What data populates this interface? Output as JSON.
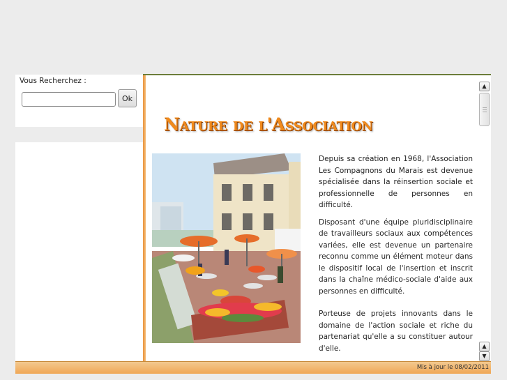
{
  "search": {
    "label": "Vous Recherchez :",
    "input_value": "",
    "ok_label": "Ok"
  },
  "main": {
    "title": "Nature de l'Association",
    "paragraphs": [
      "Depuis sa création en 1968, l'Association Les Compagnons du Marais est devenue spécialisée dans la réinsertion sociale et professionnelle de personnes en difficulté.",
      "Disposant d'une équipe pluridisciplinaire de travailleurs sociaux aux compétences variées, elle est devenue un partenaire reconnu comme un élément moteur dans le dispositif local de l'insertion et inscrit dans la chaîne médico-sociale d'aide aux personnes en difficulté.",
      "Porteuse de projets innovants dans le domaine de l'action sociale et riche du partenariat qu'elle a su constituer autour d'elle."
    ],
    "scroll_up": "▲",
    "scroll_down": "▼"
  },
  "footer": {
    "updated": "Mis à jour le 08/02/2011"
  },
  "colors": {
    "accent_orange": "#f08a1c",
    "border_green": "#6b7d3a"
  },
  "icons": {
    "up": "scroll-up-arrow-icon",
    "down": "scroll-down-arrow-icon"
  }
}
